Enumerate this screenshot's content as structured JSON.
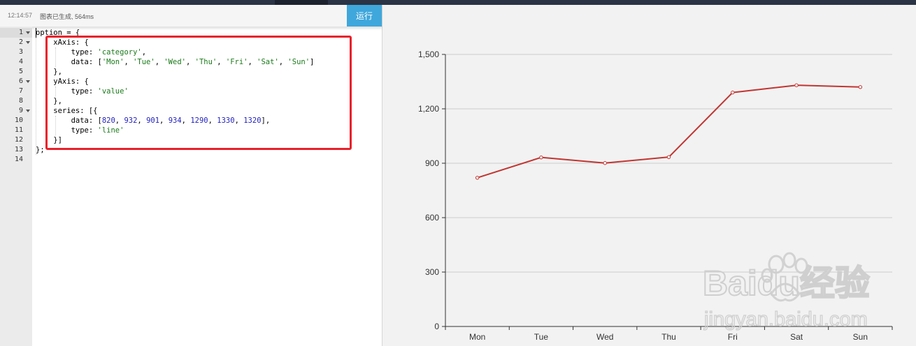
{
  "toolbar": {
    "time": "12:14:57",
    "status": "图表已生成, 564ms",
    "run_label": "运行"
  },
  "editor": {
    "line_numbers": [
      "1",
      "2",
      "3",
      "4",
      "5",
      "6",
      "7",
      "8",
      "9",
      "10",
      "11",
      "12",
      "13",
      "14"
    ],
    "folded_lines": [
      1,
      2,
      6,
      9
    ]
  },
  "chart_data": {
    "type": "line",
    "categories": [
      "Mon",
      "Tue",
      "Wed",
      "Thu",
      "Fri",
      "Sat",
      "Sun"
    ],
    "series": [
      {
        "values": [
          820,
          932,
          901,
          934,
          1290,
          1330,
          1320
        ],
        "color": "#c23531"
      }
    ],
    "ylim": [
      0,
      1500
    ],
    "yticks": [
      0,
      300,
      600,
      900,
      1200,
      1500
    ],
    "ytick_labels": [
      "0",
      "300",
      "600",
      "900",
      "1,200",
      "1,500"
    ],
    "grid": true
  },
  "colors": {
    "accent": "#3fa7dc",
    "highlight_box": "#e8202a",
    "series_line": "#c23531"
  },
  "watermark": {
    "brand": "Baidu经验",
    "url": "jingyan.baidu.com"
  }
}
